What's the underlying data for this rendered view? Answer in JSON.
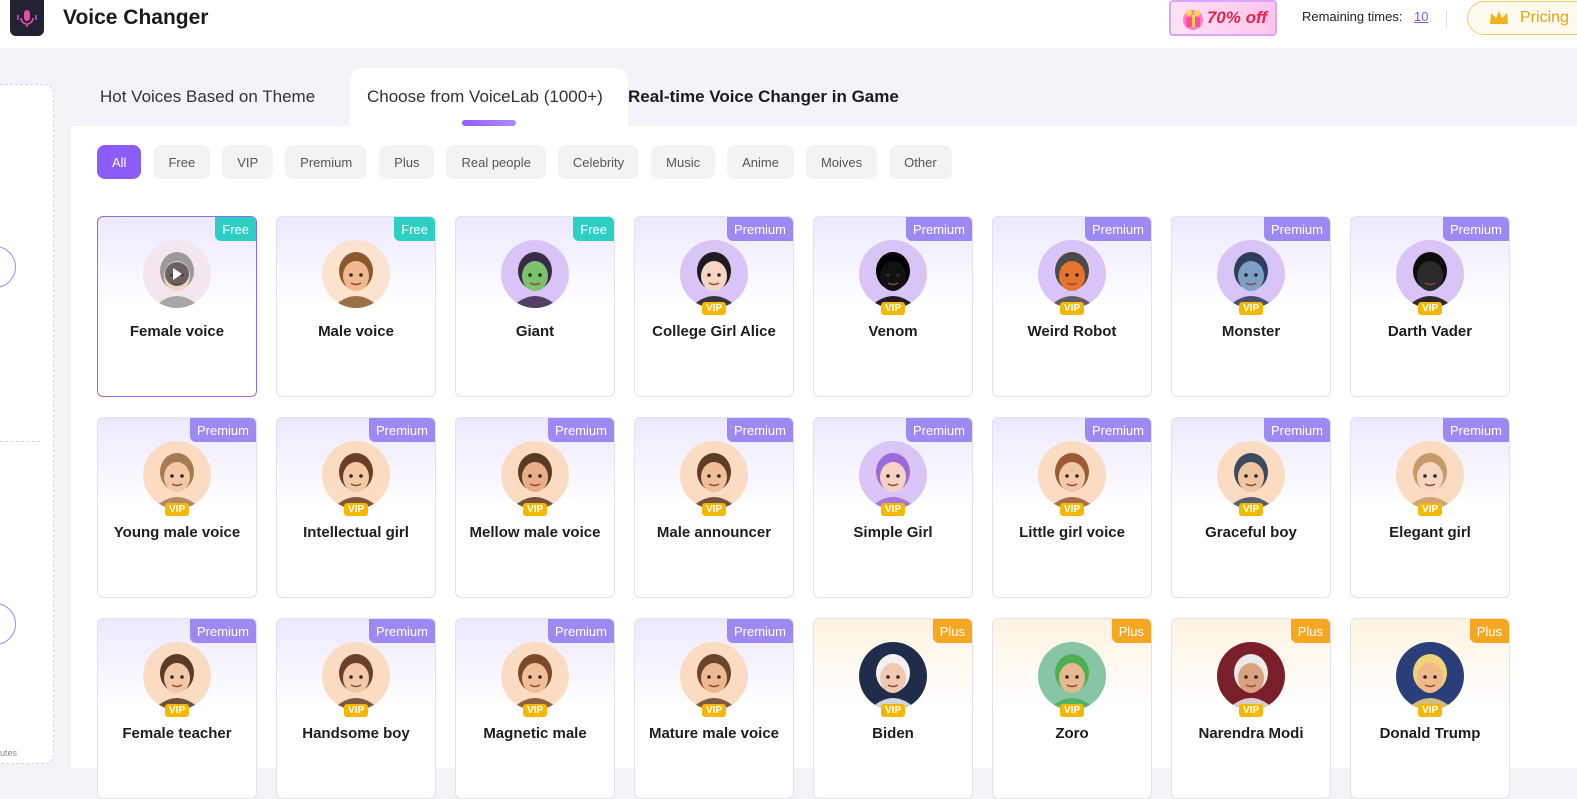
{
  "header": {
    "title": "Voice Changer",
    "promo": "70% off",
    "remaining_label": "Remaining times:",
    "remaining_value": "10",
    "pricing_label": "Pricing"
  },
  "tabs": [
    {
      "label": "Hot Voices Based on Theme"
    },
    {
      "label": "Choose from VoiceLab (1000+)"
    },
    {
      "label": "Real-time Voice Changer in Game"
    }
  ],
  "filters": [
    "All",
    "Free",
    "VIP",
    "Premium",
    "Plus",
    "Real people",
    "Celebrity",
    "Music",
    "Anime",
    "Moives",
    "Other"
  ],
  "vip_label": "VIP",
  "left_panel": {
    "tiny_text": "utes"
  },
  "colors": {
    "accent": "#8b5cf6",
    "free": "#2ecfc3",
    "premium": "#9c8af2",
    "plus": "#f5a623",
    "vip": "#f5b700"
  },
  "voices": [
    {
      "name": "Female voice",
      "badge": "Free",
      "vip": false,
      "skin": "#f6d2bd",
      "hair": "#9a9a9a",
      "bg": "#f3e6ef",
      "selected": true
    },
    {
      "name": "Male voice",
      "badge": "Free",
      "vip": false,
      "skin": "#f1b98f",
      "hair": "#8b5a2b",
      "bg": "#fbe3d0"
    },
    {
      "name": "Giant",
      "badge": "Free",
      "vip": false,
      "skin": "#7cc16b",
      "hair": "#3a2a4a",
      "bg": "#d9c4f7"
    },
    {
      "name": "College Girl Alice",
      "badge": "Premium",
      "vip": true,
      "skin": "#f6d6c3",
      "hair": "#1c1c1c",
      "bg": "#d9c4f7"
    },
    {
      "name": "Venom",
      "badge": "Premium",
      "vip": true,
      "skin": "#111111",
      "hair": "#000000",
      "bg": "#d9c4f7"
    },
    {
      "name": "Weird Robot",
      "badge": "Premium",
      "vip": true,
      "skin": "#e8732c",
      "hair": "#4a4a4a",
      "bg": "#d9c4f7"
    },
    {
      "name": "Monster",
      "badge": "Premium",
      "vip": true,
      "skin": "#7e9fc4",
      "hair": "#2e3d5a",
      "bg": "#d9c4f7"
    },
    {
      "name": "Darth Vader",
      "badge": "Premium",
      "vip": true,
      "skin": "#2a2a2a",
      "hair": "#0d0d0d",
      "bg": "#d9c4f7"
    },
    {
      "name": "Young male voice",
      "badge": "Premium",
      "vip": true,
      "skin": "#f3c8a6",
      "hair": "#a87a52",
      "bg": "#fbdcc2"
    },
    {
      "name": "Intellectual girl",
      "badge": "Premium",
      "vip": true,
      "skin": "#f3c8a6",
      "hair": "#6b3d22",
      "bg": "#fbdcc2"
    },
    {
      "name": "Mellow male voice",
      "badge": "Premium",
      "vip": true,
      "skin": "#e9ae85",
      "hair": "#5a3a24",
      "bg": "#fbdcc2"
    },
    {
      "name": "Male announcer",
      "badge": "Premium",
      "vip": true,
      "skin": "#f0bf98",
      "hair": "#5e3c28",
      "bg": "#fbdcc2"
    },
    {
      "name": "Simple Girl",
      "badge": "Premium",
      "vip": true,
      "skin": "#f6d2c4",
      "hair": "#9a6ad8",
      "bg": "#d9c4f7"
    },
    {
      "name": "Little girl voice",
      "badge": "Premium",
      "vip": true,
      "skin": "#f3c8a6",
      "hair": "#9a5a32",
      "bg": "#fbdcc2"
    },
    {
      "name": "Graceful boy",
      "badge": "Premium",
      "vip": true,
      "skin": "#f0c4a0",
      "hair": "#3b4a5e",
      "bg": "#fbdcc2"
    },
    {
      "name": "Elegant girl",
      "badge": "Premium",
      "vip": true,
      "skin": "#f6d6c3",
      "hair": "#c79a6a",
      "bg": "#fbdcc2"
    },
    {
      "name": "Female teacher",
      "badge": "Premium",
      "vip": true,
      "skin": "#f3c8a6",
      "hair": "#5a3a26",
      "bg": "#fbdcc2"
    },
    {
      "name": "Handsome boy",
      "badge": "Premium",
      "vip": true,
      "skin": "#f3c8a6",
      "hair": "#6a4028",
      "bg": "#fbdcc2"
    },
    {
      "name": "Magnetic male",
      "badge": "Premium",
      "vip": true,
      "skin": "#f0bf98",
      "hair": "#7a4a2a",
      "bg": "#fbdcc2"
    },
    {
      "name": "Mature male voice",
      "badge": "Premium",
      "vip": true,
      "skin": "#eeb890",
      "hair": "#6a4428",
      "bg": "#fbdcc2"
    },
    {
      "name": "Biden",
      "badge": "Plus",
      "vip": true,
      "skin": "#f2c9b0",
      "hair": "#f2f2f2",
      "bg": "#1f2d4a"
    },
    {
      "name": "Zoro",
      "badge": "Plus",
      "vip": true,
      "skin": "#e6b98e",
      "hair": "#4caf50",
      "bg": "#86c5a6"
    },
    {
      "name": "Narendra Modi",
      "badge": "Plus",
      "vip": true,
      "skin": "#d9a27c",
      "hair": "#e9e9e9",
      "bg": "#7a1f2a"
    },
    {
      "name": "Donald Trump",
      "badge": "Plus",
      "vip": true,
      "skin": "#f0b98a",
      "hair": "#f0d27a",
      "bg": "#2a3f7a"
    }
  ]
}
